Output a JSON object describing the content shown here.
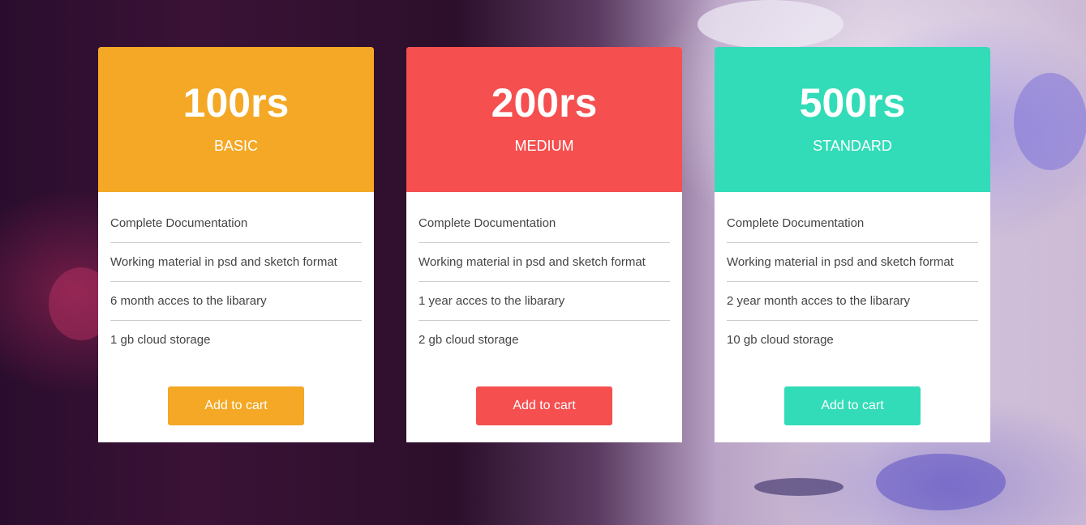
{
  "colors": {
    "basic": "#f4a825",
    "medium": "#f54f4f",
    "standard": "#32dcb8"
  },
  "plans": [
    {
      "price": "100rs",
      "name": "BASIC",
      "features": [
        "Complete Documentation",
        "Working material in psd and sketch format",
        "6 month acces to the libarary",
        "1 gb cloud storage"
      ],
      "button_label": "Add to cart"
    },
    {
      "price": "200rs",
      "name": "MEDIUM",
      "features": [
        "Complete Documentation",
        "Working material in psd and sketch format",
        "1 year acces to the libarary",
        "2 gb cloud storage"
      ],
      "button_label": "Add to cart"
    },
    {
      "price": "500rs",
      "name": "STANDARD",
      "features": [
        "Complete Documentation",
        "Working material in psd and sketch format",
        "2 year month acces to the libarary",
        "10 gb cloud storage"
      ],
      "button_label": "Add to cart"
    }
  ]
}
